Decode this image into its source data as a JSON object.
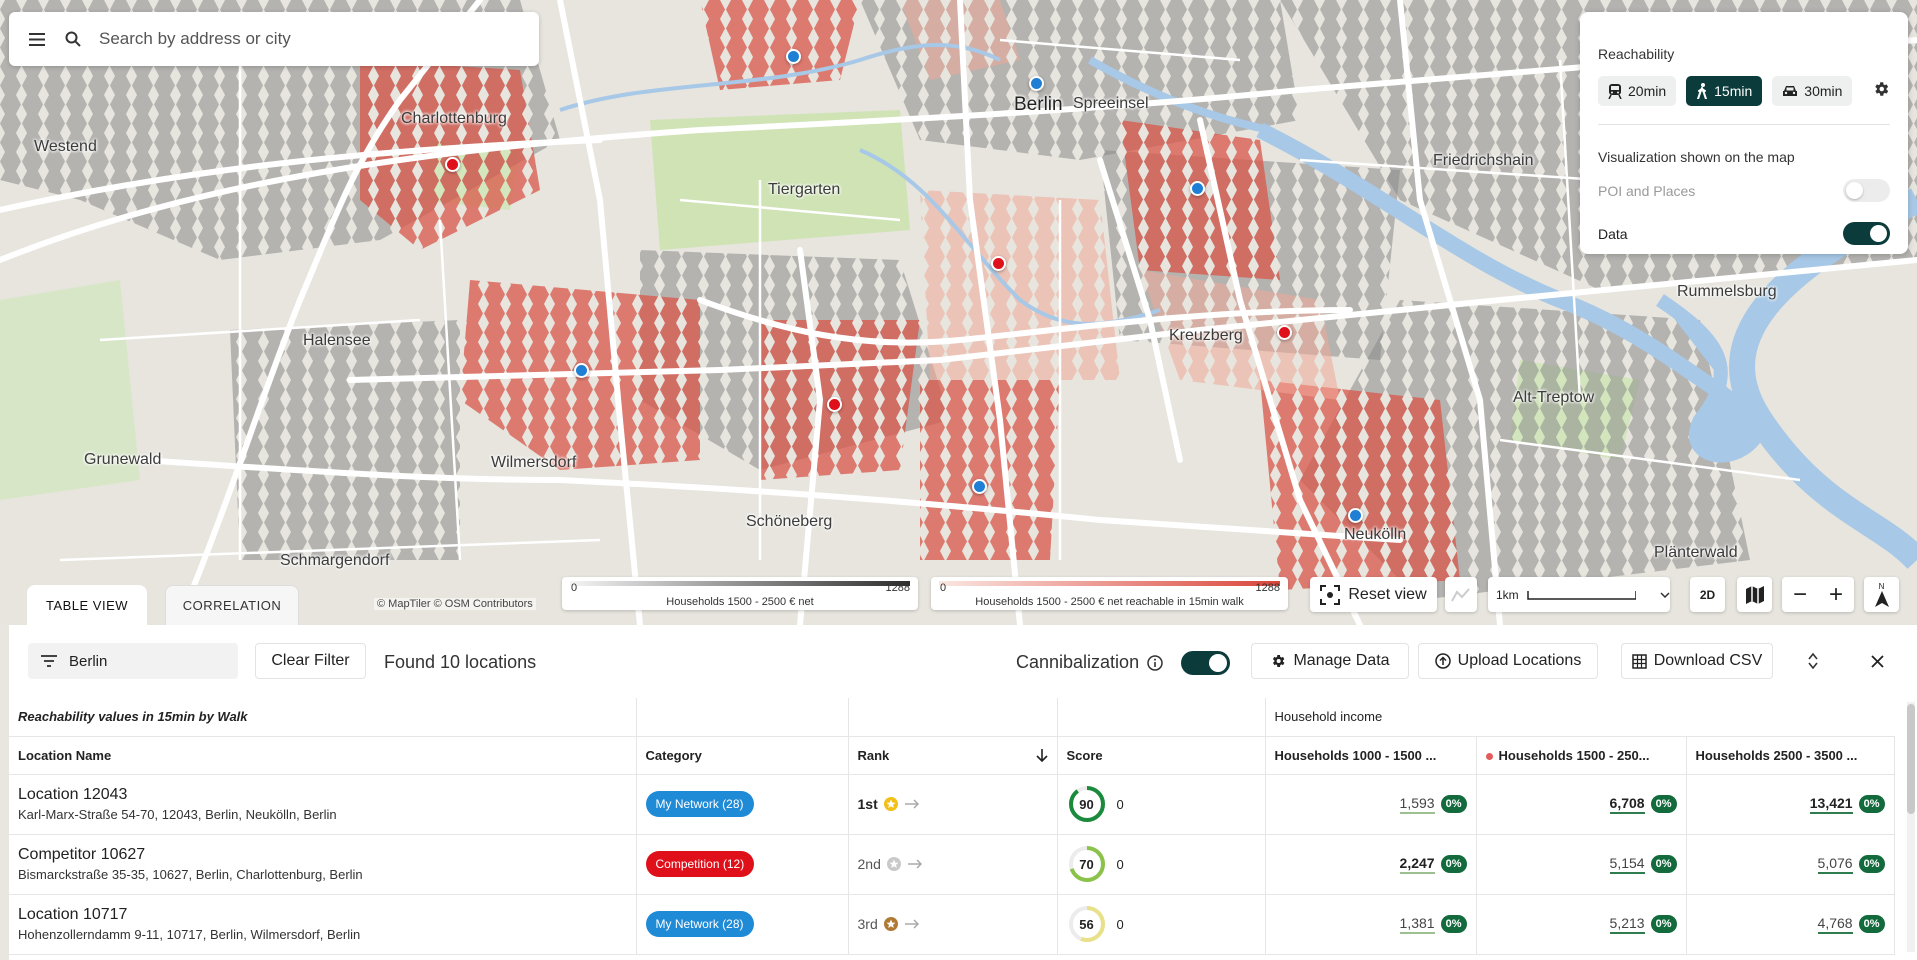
{
  "search": {
    "placeholder": "Search by address or city"
  },
  "map": {
    "labels": {
      "charlottenburg": "Charlottenburg",
      "westend": "Westend",
      "tiergarten": "Tiergarten",
      "berlin": "Berlin",
      "spreeinsel": "Spreeinsel",
      "friedrichshain": "Friedrichshain",
      "rummelsburg": "Rummelsburg",
      "halensee": "Halensee",
      "kreuzberg": "Kreuzberg",
      "alt_treptow": "Alt-Treptow",
      "grunewald": "Grunewald",
      "wilmersdorf": "Wilmersdorf",
      "schoeneberg": "Schöneberg",
      "schmargendorf": "Schmargendorf",
      "neukoelln": "Neukölln",
      "plaenterwald": "Plänterwald"
    },
    "attribution": "© MapTiler  © OSM Contributors"
  },
  "reachability": {
    "title": "Reachability",
    "modes": [
      {
        "label": "20min",
        "icon": "tram-icon",
        "active": false
      },
      {
        "label": "15min",
        "icon": "walk-icon",
        "active": true
      },
      {
        "label": "30min",
        "icon": "car-icon",
        "active": false
      }
    ],
    "viz_title": "Visualization shown on the map",
    "poi_label": "POI and Places",
    "poi_on": false,
    "data_label": "Data",
    "data_on": true
  },
  "legends": [
    {
      "min": "0",
      "max": "1288",
      "caption": "Households 1500 - 2500 € net"
    },
    {
      "min": "0",
      "max": "1288",
      "caption": "Households 1500 - 2500 € net reachable in 15min walk"
    }
  ],
  "controls": {
    "reset_view": "Reset view",
    "scale_label": "1km",
    "mode_2d": "2D",
    "compass_n": "N"
  },
  "tabs": {
    "table_view": "TABLE VIEW",
    "correlation": "CORRELATION"
  },
  "toolbar": {
    "filter_value": "Berlin",
    "clear_filter": "Clear Filter",
    "found": "Found 10 locations",
    "cannibalization": "Cannibalization",
    "cannibalization_on": true,
    "manage_data": "Manage Data",
    "upload_locations": "Upload Locations",
    "download_csv": "Download CSV"
  },
  "table": {
    "group_header": "Reachability values in 15min by Walk",
    "household_group": "Household income",
    "columns": {
      "location": "Location Name",
      "category": "Category",
      "rank": "Rank",
      "score": "Score",
      "hh1": "Households 1000 - 1500 ...",
      "hh2": "Households 1500 - 250...",
      "hh3": "Households 2500 - 3500 ..."
    },
    "rows": [
      {
        "name": "Location 12043",
        "address": "Karl-Marx-Straße 54-70, 12043, Berlin, Neukölln, Berlin",
        "category": "My Network (28)",
        "category_color": "#1f8ad6",
        "rank": "1st",
        "medal_color": "#f2c018",
        "score": "90",
        "score_delta": "0",
        "score_color": "#1a8a3c",
        "hh1": "1,593",
        "hh1_pct": "0%",
        "hh2": "6,708",
        "hh2_pct": "0%",
        "hh3": "13,421",
        "hh3_pct": "0%"
      },
      {
        "name": "Competitor 10627",
        "address": "Bismarckstraße 35-35, 10627, Berlin, Charlottenburg, Berlin",
        "category": "Competition (12)",
        "category_color": "#e0101a",
        "rank": "2nd",
        "medal_color": "#c9c9c9",
        "score": "70",
        "score_delta": "0",
        "score_color": "#8bc24a",
        "hh1": "2,247",
        "hh1_pct": "0%",
        "hh2": "5,154",
        "hh2_pct": "0%",
        "hh3": "5,076",
        "hh3_pct": "0%"
      },
      {
        "name": "Location 10717",
        "address": "Hohenzollerndamm 9-11, 10717, Berlin, Wilmersdorf, Berlin",
        "category": "My Network (28)",
        "category_color": "#1f8ad6",
        "rank": "3rd",
        "medal_color": "#b07a35",
        "score": "56",
        "score_delta": "0",
        "score_color": "#e9e08a",
        "hh1": "1,381",
        "hh1_pct": "0%",
        "hh2": "5,213",
        "hh2_pct": "0%",
        "hh3": "4,768",
        "hh3_pct": "0%"
      }
    ]
  }
}
